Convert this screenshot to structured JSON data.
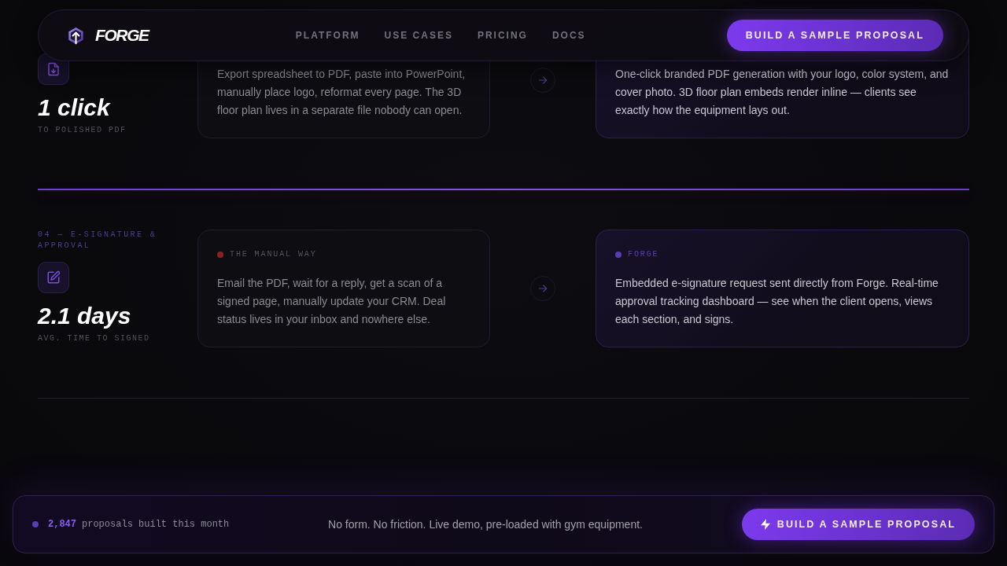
{
  "nav": {
    "logo": "FORGE",
    "links": [
      "PLATFORM",
      "USE CASES",
      "PRICING",
      "DOCS"
    ],
    "cta": "BUILD A SAMPLE PROPOSAL"
  },
  "rows": [
    {
      "metric": "1 click",
      "metric_caption": "TO POLISHED PDF",
      "active": true,
      "manual": {
        "text": "Export spreadsheet to PDF, paste into PowerPoint, manually place logo, reformat every page. The 3D floor plan lives in a separate file nobody can open."
      },
      "forge": {
        "text": "One-click branded PDF generation with your logo, color system, and cover photo. 3D floor plan embeds render inline — clients see exactly how the equipment lays out."
      }
    },
    {
      "label": "04 — E-SIGNATURE & APPROVAL",
      "metric": "2.1 days",
      "metric_caption": "AVG. TIME TO SIGNED",
      "active": false,
      "manual": {
        "tag": "THE MANUAL WAY",
        "text": "Email the PDF, wait for a reply, get a scan of a signed page, manually update your CRM. Deal status lives in your inbox and nowhere else."
      },
      "forge": {
        "tag": "FORGE",
        "text": "Embedded e-signature request sent directly from Forge. Real-time approval tracking dashboard — see when the client opens, views each section, and signs."
      }
    }
  ],
  "bottom_bar": {
    "count": "2,847",
    "count_label": "proposals built this month",
    "message": "No form. No friction. Live demo, pre-loaded with gym equipment.",
    "cta": "BUILD A SAMPLE PROPOSAL"
  }
}
